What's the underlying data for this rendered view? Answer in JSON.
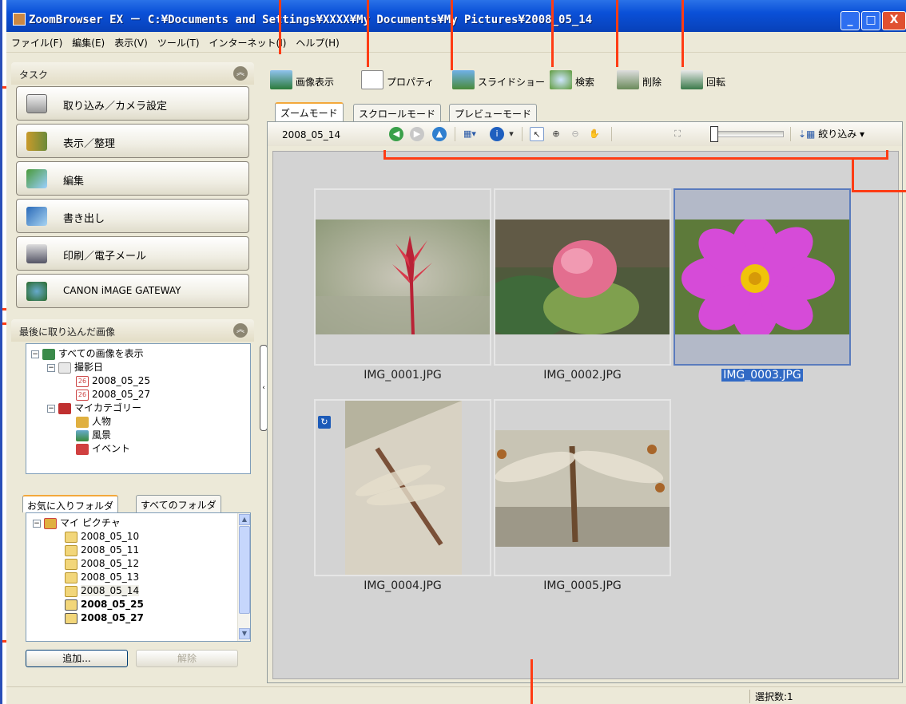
{
  "window": {
    "title": "ZoomBrowser EX  －  C:¥Documents and Settings¥XXXX¥My Documents¥My Pictures¥2008_05_14",
    "controls": {
      "minimize": "_",
      "maximize": "□",
      "close": "X"
    }
  },
  "menu": [
    "ファイル(F)",
    "編集(E)",
    "表示(V)",
    "ツール(T)",
    "インターネット(I)",
    "ヘルプ(H)"
  ],
  "task_panel": {
    "header": "タスク",
    "buttons": [
      "取り込み／カメラ設定",
      "表示／整理",
      "編集",
      "書き出し",
      "印刷／電子メール",
      "CANON iMAGE GATEWAY"
    ]
  },
  "recent_panel": {
    "header": "最後に取り込んだ画像",
    "tree": {
      "root": "すべての画像を表示",
      "date_group": "撮影日",
      "dates": [
        "2008_05_25",
        "2008_05_27"
      ],
      "category_group": "マイカテゴリー",
      "categories": [
        "人物",
        "風景",
        "イベント"
      ]
    }
  },
  "folder_panel": {
    "tabs": [
      "お気に入りフォルダ",
      "すべてのフォルダ"
    ],
    "root": "マイ ピクチャ",
    "folders": [
      "2008_05_10",
      "2008_05_11",
      "2008_05_12",
      "2008_05_13",
      "2008_05_14",
      "2008_05_25",
      "2008_05_27"
    ],
    "add_button": "追加...",
    "remove_button": "解除"
  },
  "toolbar": [
    "画像表示",
    "プロパティ",
    "スライドショー",
    "検索",
    "削除",
    "回転"
  ],
  "view_tabs": [
    "ズームモード",
    "スクロールモード",
    "プレビューモード"
  ],
  "view_bar": {
    "path": "2008_05_14",
    "filter": "絞り込み"
  },
  "thumbnails": [
    "IMG_0001.JPG",
    "IMG_0002.JPG",
    "IMG_0003.JPG",
    "IMG_0004.JPG",
    "IMG_0005.JPG"
  ],
  "status": {
    "selected": "選択数:1"
  },
  "colors": {
    "titlebar": "#0a50d8",
    "selection": "#316ac5",
    "callout": "#ff3c14",
    "tab_accent": "#f3a83b"
  }
}
